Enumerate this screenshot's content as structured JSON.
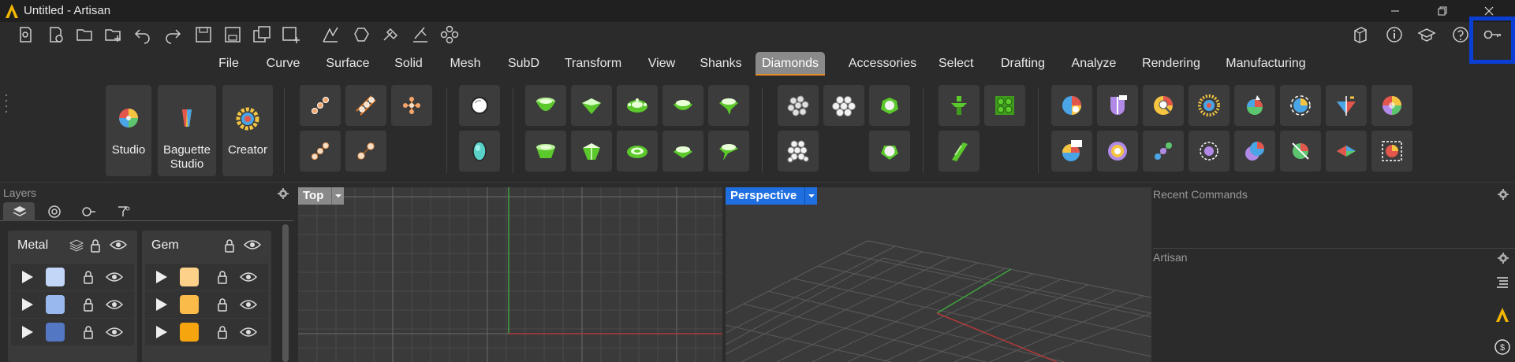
{
  "window": {
    "title": "Untitled - Artisan",
    "controls": [
      "minimize-icon",
      "restore-icon",
      "close-icon"
    ]
  },
  "quick_toolbar": {
    "icons": [
      "open-recent-icon",
      "history-icon",
      "open-folder-icon",
      "import-icon",
      "undo-icon",
      "redo-icon",
      "save-icon",
      "save-as-icon",
      "save-small-icon",
      "save-add-icon",
      "curve-tool-icon",
      "polygon-tool-icon",
      "boolean-icon",
      "edit-curve-icon",
      "gumball-icon"
    ],
    "right_icons": [
      "gem-cube-icon",
      "info-icon",
      "tutorial-icon",
      "help-icon",
      "license-key-icon"
    ]
  },
  "menu": {
    "items": [
      "File",
      "Curve",
      "Surface",
      "Solid",
      "Mesh",
      "SubD",
      "Transform",
      "View",
      "Shanks",
      "Diamonds",
      "Accessories",
      "Select",
      "Drafting",
      "Analyze",
      "Rendering",
      "Manufacturing"
    ],
    "active": "Diamonds"
  },
  "ribbon": {
    "big_buttons": [
      {
        "label": "Studio"
      },
      {
        "label": "Baguette\nStudio"
      },
      {
        "label": "Creator"
      }
    ],
    "accent_green": "#5bc82c",
    "accent_cyan": "#5ad1c8"
  },
  "layers_panel": {
    "title": "Layers",
    "tabs": [
      "layers-tab-icon",
      "materials-tab-icon",
      "keys-tab-icon",
      "filter-tab-icon"
    ],
    "cards": [
      {
        "name": "Metal",
        "swatches": [
          "#c3d6f7",
          "#98b8ee",
          "#5477c4"
        ]
      },
      {
        "name": "Gem",
        "swatches": [
          "#fdd18a",
          "#fbbb48",
          "#f7a50f"
        ]
      }
    ]
  },
  "viewports": {
    "top": {
      "label": "Top"
    },
    "perspective": {
      "label": "Perspective"
    }
  },
  "right_panels": {
    "recent": "Recent Commands",
    "artisan": "Artisan"
  }
}
